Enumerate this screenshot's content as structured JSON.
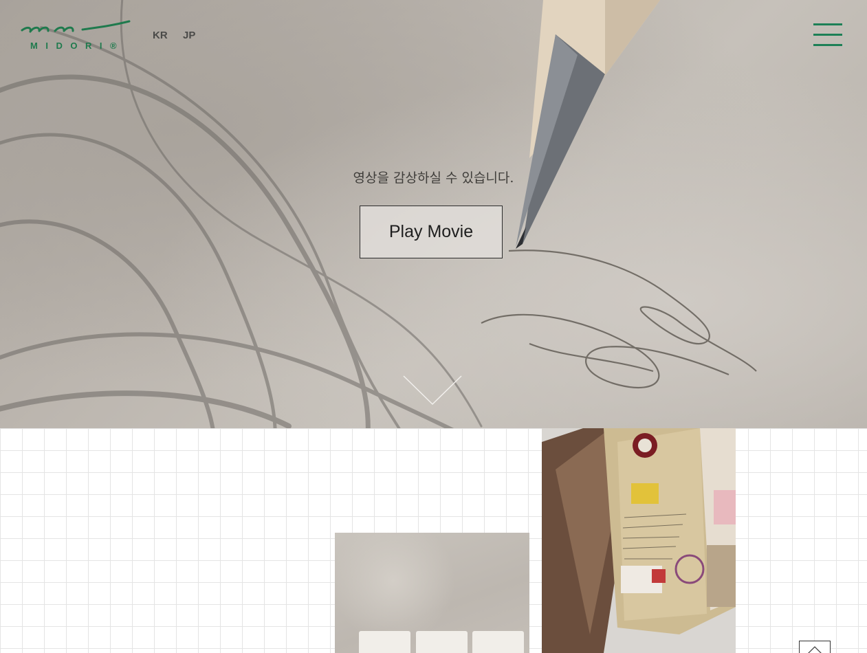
{
  "header": {
    "logo_text": "MIDORI®",
    "languages": [
      "KR",
      "JP"
    ],
    "menu_icon": "hamburger-menu-icon"
  },
  "hero": {
    "caption": "영상을 감상하실 수 있습니다.",
    "play_label": "Play Movie",
    "scroll_icon": "chevron-down-icon"
  },
  "content": {
    "back_to_top_icon": "arrow-up-icon"
  },
  "colors": {
    "brand_green": "#1d8056",
    "grid_line": "#e4e4e4"
  }
}
